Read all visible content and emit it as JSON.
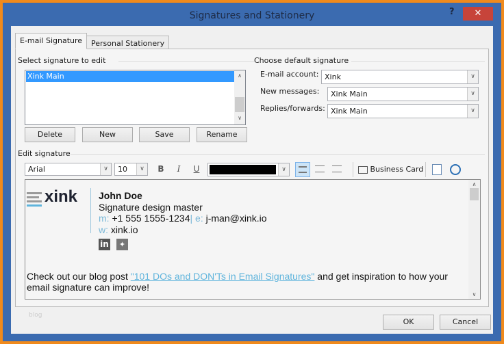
{
  "window": {
    "title": "Signatures and Stationery",
    "help": "?",
    "close": "✕"
  },
  "tabs": [
    {
      "label": "E-mail Signature",
      "active": true
    },
    {
      "label": "Personal Stationery",
      "active": false
    }
  ],
  "select_sig": {
    "heading": "Select signature to edit",
    "items": [
      "Xink Main"
    ],
    "buttons": {
      "delete": "Delete",
      "new": "New",
      "save": "Save",
      "rename": "Rename"
    }
  },
  "defaults": {
    "heading": "Choose default signature",
    "account_label": "E-mail account:",
    "account_value": "Xink",
    "new_label": "New messages:",
    "new_value": "Xink Main",
    "replies_label": "Replies/forwards:",
    "replies_value": "Xink Main"
  },
  "edit": {
    "heading": "Edit signature",
    "font": "Arial",
    "size": "10",
    "bold": "B",
    "italic": "I",
    "underline": "U",
    "color": "#000000",
    "business_card": "Business Card"
  },
  "signature": {
    "logo": "xink",
    "name": "John Doe",
    "title": "Signature design master",
    "m_label": "m:",
    "phone": "+1 555 1555-1234",
    "e_label": "e:",
    "email": "j-man@xink.io",
    "w_label": "w:",
    "web": "xink.io",
    "linkedin": "in",
    "blog_pre": "Check out our blog post ",
    "blog_link": "\"101 DOs and DON'Ts in Email Signatures\"",
    "blog_post": " and get inspiration to how your email signature can improve!"
  },
  "footer": {
    "faint": "blog",
    "ok": "OK",
    "cancel": "Cancel"
  },
  "colors": {
    "accent": "#3b6bb0",
    "selection": "#3399ff",
    "link": "#5fb4dc",
    "border": "#f08a1c"
  }
}
